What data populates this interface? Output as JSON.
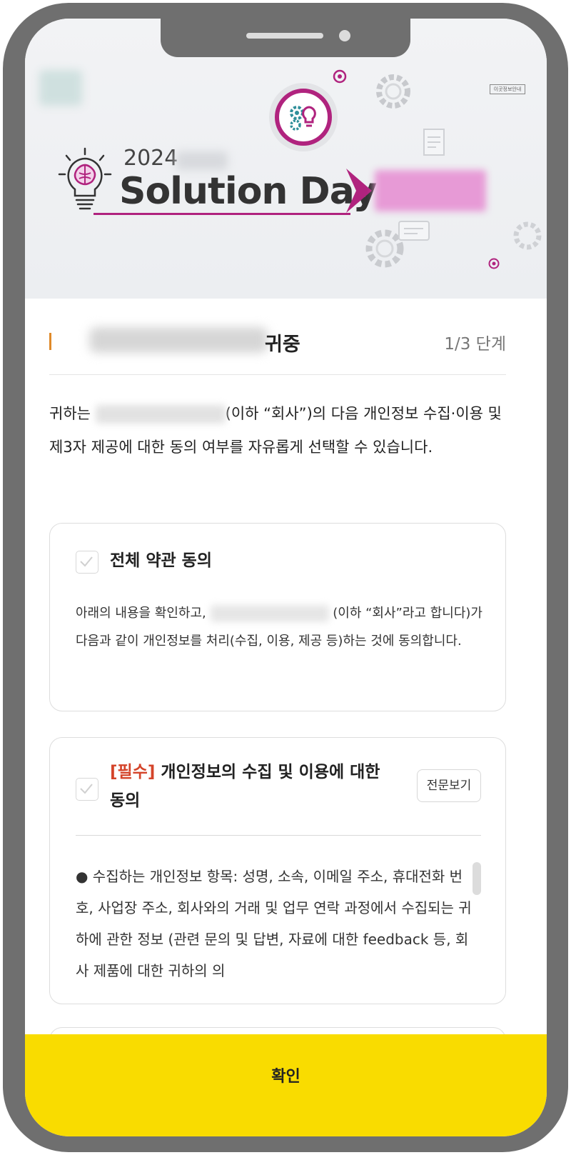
{
  "banner": {
    "year": "2024",
    "title": "Solution Day",
    "corner_tag": "이곳정보안내"
  },
  "header": {
    "title_suffix": "귀중",
    "step": "1/3 단계"
  },
  "intro": {
    "part1": "귀하는",
    "part2": "(이하 “회사”)의 다음 개인정보 수집·이용 및 제3자 제공에 대한 동의 여부를 자유롭게 선택할 수 있습니다."
  },
  "agree_all": {
    "title": "전체 약관 동의",
    "body_part1": "아래의 내용을 확인하고,",
    "body_part2": "(이하 “회사”라고 합니다)가 다음과 같이 개인정보를 처리(수집, 이용, 제공 등)하는 것에 동의합니다."
  },
  "consent_personal_info": {
    "required_tag": "[필수]",
    "title": "개인정보의 수집 및 이용에 대한 동의",
    "view_full_label": "전문보기",
    "body": "● 수집하는 개인정보 항목: 성명, 소속, 이메일 주소, 휴대전화 번호, 사업장 주소, 회사와의 거래 및 업무 연락 과정에서 수집되는 귀하에 관한 정보 (관련 문의 및 답변, 자료에 대한 feedback 등, 회사 제품에 대한 귀하의 의"
  },
  "footer": {
    "confirm_label": "확인"
  },
  "colors": {
    "brand_magenta": "#b0237e",
    "confirm_yellow": "#f9dc00",
    "required_red": "#d4442a",
    "accent_orange": "#e08a2a"
  }
}
